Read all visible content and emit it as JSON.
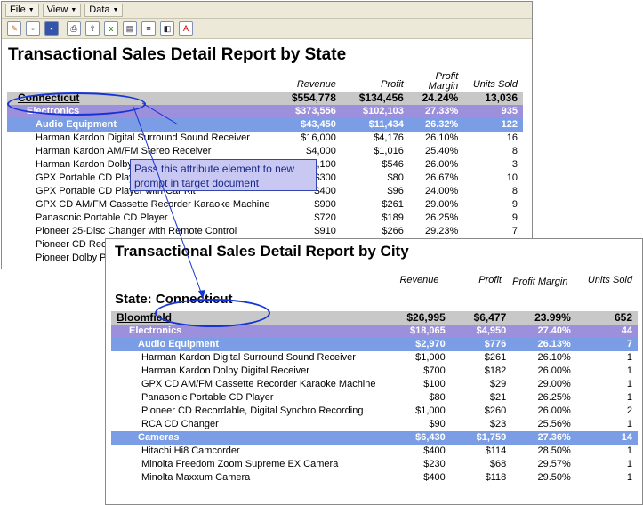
{
  "win1": {
    "menus": [
      "File",
      "View",
      "Data"
    ],
    "toolbar_icons": [
      "edit-icon",
      "new-icon",
      "save-icon",
      "print-icon",
      "export-icon",
      "excel-icon",
      "pdf-icon",
      "text-icon",
      "html-icon",
      "pdf-export-icon"
    ],
    "title": "Transactional Sales Detail Report by State",
    "headers": {
      "revenue": "Revenue",
      "profit": "Profit",
      "margin": "Profit Margin",
      "units": "Units Sold"
    },
    "state_row": {
      "name": "Connecticut",
      "revenue": "$554,778",
      "profit": "$134,456",
      "margin": "24.24%",
      "units": "13,036"
    },
    "category_row": {
      "name": "Electronics",
      "revenue": "$373,556",
      "profit": "$102,103",
      "margin": "27.33%",
      "units": "935"
    },
    "subcategory_row": {
      "name": "Audio Equipment",
      "revenue": "$43,450",
      "profit": "$11,434",
      "margin": "26.32%",
      "units": "122"
    },
    "items": [
      {
        "name": "Harman Kardon Digital Surround Sound Receiver",
        "revenue": "$16,000",
        "profit": "$4,176",
        "margin": "26.10%",
        "units": "16"
      },
      {
        "name": "Harman Kardon AM/FM Stereo Receiver",
        "revenue": "$4,000",
        "profit": "$1,016",
        "margin": "25.40%",
        "units": "8"
      },
      {
        "name": "Harman Kardon Dolby Digital Receiver",
        "revenue": "$2,100",
        "profit": "$546",
        "margin": "26.00%",
        "units": "3"
      },
      {
        "name": "GPX Portable CD Player",
        "revenue": "$300",
        "profit": "$80",
        "margin": "26.67%",
        "units": "10"
      },
      {
        "name": "GPX Portable CD Player with Car Kit",
        "revenue": "$400",
        "profit": "$96",
        "margin": "24.00%",
        "units": "8"
      },
      {
        "name": "GPX CD AM/FM Cassette Recorder Karaoke Machine",
        "revenue": "$900",
        "profit": "$261",
        "margin": "29.00%",
        "units": "9"
      },
      {
        "name": "Panasonic Portable CD Player",
        "revenue": "$720",
        "profit": "$189",
        "margin": "26.25%",
        "units": "9"
      },
      {
        "name": "Pioneer 25-Disc Changer with Remote Control",
        "revenue": "$910",
        "profit": "$266",
        "margin": "29.23%",
        "units": "7"
      },
      {
        "name": "Pioneer CD Recordable, Digital Synchro Recording",
        "revenue": "",
        "profit": "",
        "margin": "",
        "units": ""
      },
      {
        "name": "Pioneer Dolby Pro Logic Receiver",
        "revenue": "",
        "profit": "",
        "margin": "",
        "units": ""
      }
    ]
  },
  "callout": {
    "text": "Pass this attribute element to new prompt in target document"
  },
  "win2": {
    "title": "Transactional Sales Detail Report by City",
    "headers": {
      "revenue": "Revenue",
      "profit": "Profit",
      "margin": "Profit Margin",
      "units": "Units Sold"
    },
    "state_label": "State:",
    "state_value": "Connecticut",
    "city_row": {
      "name": "Bloomfield",
      "revenue": "$26,995",
      "profit": "$6,477",
      "margin": "23.99%",
      "units": "652"
    },
    "category_row": {
      "name": "Electronics",
      "revenue": "$18,065",
      "profit": "$4,950",
      "margin": "27.40%",
      "units": "44"
    },
    "subcategory_row": {
      "name": "Audio Equipment",
      "revenue": "$2,970",
      "profit": "$776",
      "margin": "26.13%",
      "units": "7"
    },
    "audio_items": [
      {
        "name": "Harman Kardon Digital Surround Sound Receiver",
        "revenue": "$1,000",
        "profit": "$261",
        "margin": "26.10%",
        "units": "1"
      },
      {
        "name": "Harman Kardon Dolby Digital Receiver",
        "revenue": "$700",
        "profit": "$182",
        "margin": "26.00%",
        "units": "1"
      },
      {
        "name": "GPX CD AM/FM Cassette Recorder Karaoke Machine",
        "revenue": "$100",
        "profit": "$29",
        "margin": "29.00%",
        "units": "1"
      },
      {
        "name": "Panasonic Portable CD Player",
        "revenue": "$80",
        "profit": "$21",
        "margin": "26.25%",
        "units": "1"
      },
      {
        "name": "Pioneer CD Recordable, Digital Synchro Recording",
        "revenue": "$1,000",
        "profit": "$260",
        "margin": "26.00%",
        "units": "2"
      },
      {
        "name": "RCA CD Changer",
        "revenue": "$90",
        "profit": "$23",
        "margin": "25.56%",
        "units": "1"
      }
    ],
    "cameras_row": {
      "name": "Cameras",
      "revenue": "$6,430",
      "profit": "$1,759",
      "margin": "27.36%",
      "units": "14"
    },
    "camera_items": [
      {
        "name": "Hitachi Hi8 Camcorder",
        "revenue": "$400",
        "profit": "$114",
        "margin": "28.50%",
        "units": "1"
      },
      {
        "name": "Minolta Freedom Zoom Supreme EX Camera",
        "revenue": "$230",
        "profit": "$68",
        "margin": "29.57%",
        "units": "1"
      },
      {
        "name": "Minolta Maxxum Camera",
        "revenue": "$400",
        "profit": "$118",
        "margin": "29.50%",
        "units": "1"
      }
    ]
  },
  "colors": {
    "state_row": "#c8c8c8",
    "category_row": "#9c8fdb",
    "subcategory_row": "#7a9de6",
    "highlight_oval": "#1533d6",
    "callout_bg": "#c8c8f2"
  }
}
